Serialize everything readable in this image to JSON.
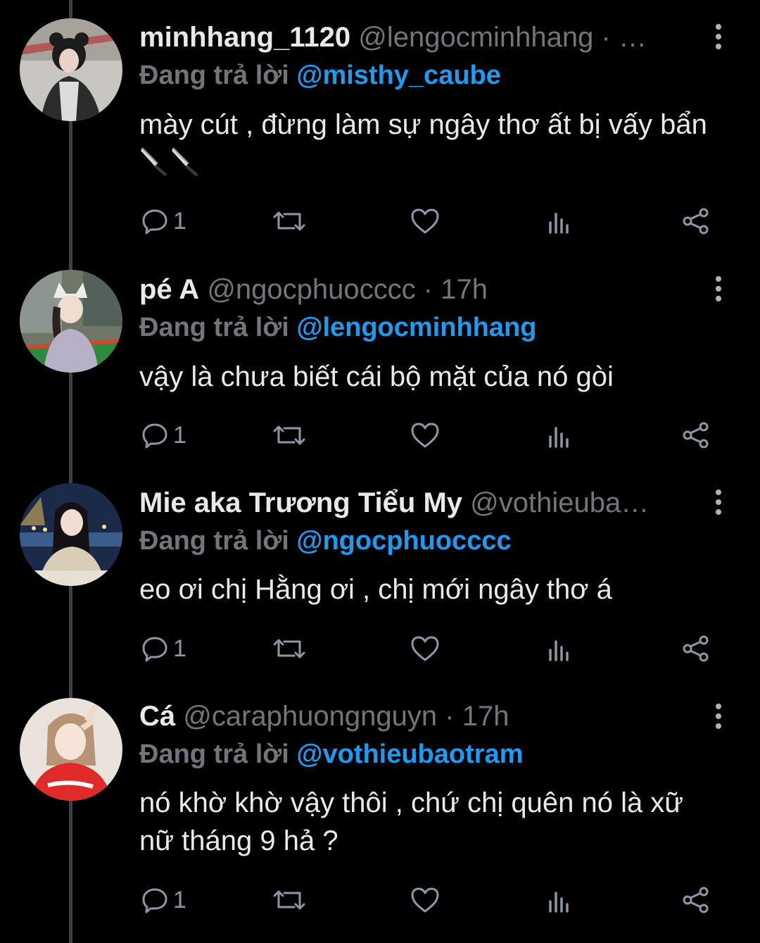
{
  "tweets": [
    {
      "display_name": "minhhang_1120",
      "handle": "@lengocminhhang",
      "separator": "·",
      "time": "…",
      "replying_label": "Đang trả lời",
      "replying_to": "@misthy_caube",
      "text": "mày cút , đừng làm sự ngây thơ ất bị vấy bẩn",
      "emoji": [
        "kitchen-knife",
        "kitchen-knife"
      ],
      "reply_count": "1"
    },
    {
      "display_name": "pé A",
      "handle": "@ngocphuocccc",
      "separator": "·",
      "time": "17h",
      "replying_label": "Đang trả lời",
      "replying_to": "@lengocminhhang",
      "text": "vậy là chưa biết cái bộ mặt của nó gòi",
      "reply_count": "1"
    },
    {
      "display_name": "Mie aka Trương Tiểu My",
      "handle": "@vothieuba…",
      "separator": "",
      "time": "",
      "replying_label": "Đang trả lời",
      "replying_to": "@ngocphuocccc",
      "text": "eo ơi chị Hằng ơi , chị mới ngây thơ á",
      "reply_count": "1"
    },
    {
      "display_name": "Cá",
      "handle": "@caraphuongnguyn",
      "separator": "·",
      "time": "17h",
      "replying_label": "Đang trả lời",
      "replying_to": "@vothieubaotram",
      "text": "nó khờ khờ vậy thôi , chứ chị quên nó là xữ nữ tháng 9 hả ?",
      "reply_count": "1"
    }
  ],
  "icons": {
    "reply": "reply-bubble-icon",
    "retweet": "retweet-icon",
    "like": "heart-icon",
    "analytics": "bar-chart-icon",
    "share": "share-icon",
    "more": "more-vertical-icon"
  },
  "colors": {
    "background": "#000000",
    "text": "#e7e9ea",
    "muted": "#71767b",
    "link": "#1d9bf0",
    "thread_line": "#3e4144"
  }
}
